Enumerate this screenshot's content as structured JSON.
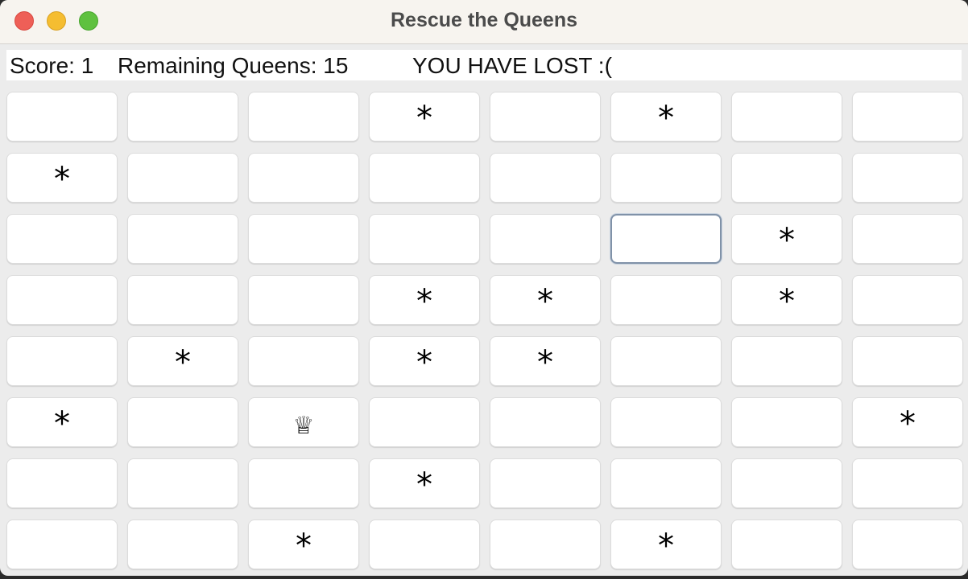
{
  "window": {
    "title": "Rescue the Queens"
  },
  "status": {
    "score_text": "Score: 1",
    "remaining_text": "Remaining Queens: 15",
    "result_text": "YOU HAVE LOST :("
  },
  "board": {
    "rows": [
      [
        "",
        "",
        "",
        "*",
        "",
        "*",
        "",
        ""
      ],
      [
        "*",
        "",
        "",
        "",
        "",
        "",
        "",
        ""
      ],
      [
        "",
        "",
        "",
        "",
        "",
        "",
        "*",
        ""
      ],
      [
        "",
        "",
        "",
        "*",
        "*",
        "",
        "*",
        ""
      ],
      [
        "",
        "*",
        "",
        "*",
        "*",
        "",
        "",
        ""
      ],
      [
        "*",
        "",
        "♕",
        "",
        "",
        "",
        "",
        "*"
      ],
      [
        "",
        "",
        "",
        "*",
        "",
        "",
        "",
        ""
      ],
      [
        "",
        "",
        "*",
        "",
        "",
        "*",
        "",
        ""
      ]
    ],
    "focused_cell": {
      "row": 2,
      "col": 5
    }
  }
}
